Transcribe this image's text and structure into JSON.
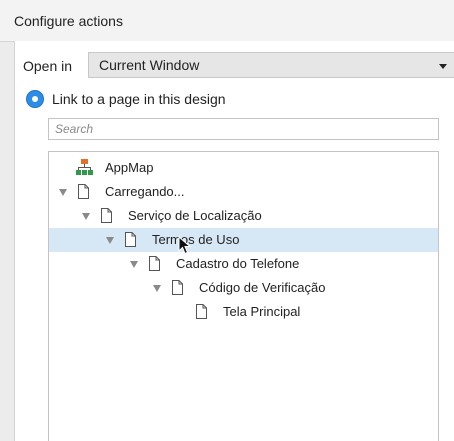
{
  "header": {
    "title": "Configure actions"
  },
  "open_in": {
    "label": "Open in",
    "selected": "Current Window"
  },
  "link_option": {
    "label": "Link to a page in this design",
    "selected": true
  },
  "search": {
    "placeholder": "Search",
    "value": ""
  },
  "tree": {
    "items": [
      {
        "label": "AppMap",
        "icon": "sitemap-icon",
        "expanded": null,
        "selected": false
      },
      {
        "label": "Carregando...",
        "icon": "page-icon",
        "expanded": true,
        "selected": false
      },
      {
        "label": "Serviço de Localização",
        "icon": "page-icon",
        "expanded": true,
        "selected": false
      },
      {
        "label": "Termos de Uso",
        "icon": "page-icon",
        "expanded": true,
        "selected": true
      },
      {
        "label": "Cadastro do Telefone",
        "icon": "page-icon",
        "expanded": true,
        "selected": false
      },
      {
        "label": "Código de Verificação",
        "icon": "page-icon",
        "expanded": true,
        "selected": false
      },
      {
        "label": "Tela Principal",
        "icon": "page-icon",
        "expanded": null,
        "selected": false
      }
    ]
  },
  "colors": {
    "accent": "#2d8de6",
    "selection": "#d6e8f6",
    "sitemap_top": "#e0702a",
    "sitemap_bottom": "#2f9a4a"
  }
}
